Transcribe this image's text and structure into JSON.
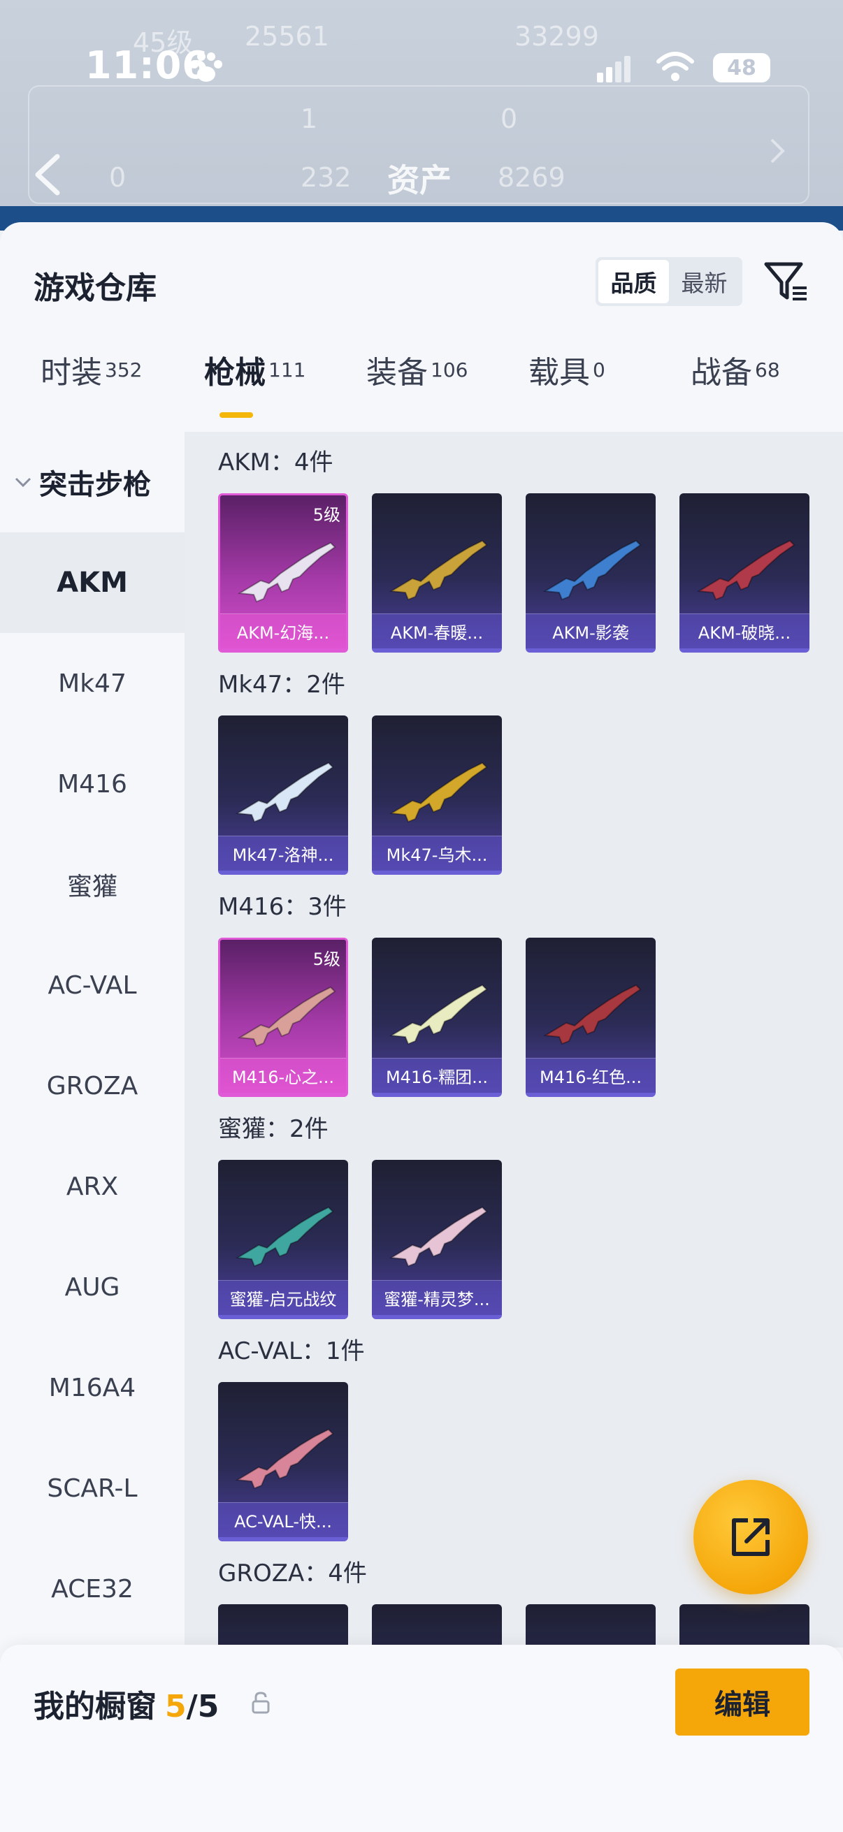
{
  "status_bar": {
    "time": "11:06",
    "battery": "48"
  },
  "background": {
    "ghost_texts": [
      "45级",
      "25561",
      "33299",
      "1",
      "0",
      "0",
      "232",
      "8269"
    ],
    "asset_title": "资产"
  },
  "header": {
    "title": "游戏仓库",
    "sort_options": [
      "品质",
      "最新"
    ],
    "active_sort": "品质"
  },
  "tabs": [
    {
      "label": "时装",
      "count": "352"
    },
    {
      "label": "枪械",
      "count": "111",
      "active": true
    },
    {
      "label": "装备",
      "count": "106"
    },
    {
      "label": "载具",
      "count": "0"
    },
    {
      "label": "战备",
      "count": "68"
    }
  ],
  "sidebar": {
    "group": "突击步枪",
    "items": [
      "AKM",
      "Mk47",
      "M416",
      "蜜獾",
      "AC-VAL",
      "GROZA",
      "ARX",
      "AUG",
      "M16A4",
      "SCAR-L",
      "ACE32"
    ],
    "active": "AKM"
  },
  "sections": [
    {
      "title": "AKM：4件",
      "items": [
        {
          "label": "AKM-幻海...",
          "grade": "5级",
          "rarity": "purple",
          "gun_color": "#e8e2f0"
        },
        {
          "label": "AKM-春暖...",
          "rarity": "blue",
          "gun_color": "#c9a23a"
        },
        {
          "label": "AKM-影袭",
          "rarity": "blue",
          "gun_color": "#3f7fd0"
        },
        {
          "label": "AKM-破晓...",
          "rarity": "blue",
          "gun_color": "#b0394a"
        }
      ]
    },
    {
      "title": "Mk47：2件",
      "items": [
        {
          "label": "Mk47-洛神...",
          "rarity": "blue",
          "gun_color": "#d8e6f5"
        },
        {
          "label": "Mk47-乌木...",
          "rarity": "blue",
          "gun_color": "#d2a72a"
        }
      ]
    },
    {
      "title": "M416：3件",
      "items": [
        {
          "label": "M416-心之...",
          "grade": "5级",
          "rarity": "purple",
          "gun_color": "#d9a09a"
        },
        {
          "label": "M416-糯团...",
          "rarity": "blue",
          "gun_color": "#e8ecc0"
        },
        {
          "label": "M416-红色...",
          "rarity": "blue",
          "gun_color": "#a8383f"
        }
      ]
    },
    {
      "title": "蜜獾：2件",
      "items": [
        {
          "label": "蜜獾-启元战纹",
          "rarity": "blue",
          "gun_color": "#3fa7a0"
        },
        {
          "label": "蜜獾-精灵梦...",
          "rarity": "blue",
          "gun_color": "#e6c4d6"
        }
      ]
    },
    {
      "title": "AC-VAL：1件",
      "items": [
        {
          "label": "AC-VAL-快...",
          "rarity": "blue",
          "gun_color": "#d8859a"
        }
      ]
    },
    {
      "title": "GROZA：4件",
      "items": [
        {
          "label": "",
          "rarity": "blue",
          "gun_color": "#c9a23a"
        },
        {
          "label": "",
          "rarity": "blue",
          "gun_color": "#e07a3a"
        },
        {
          "label": "",
          "rarity": "blue",
          "gun_color": "#c9a23a"
        },
        {
          "label": "",
          "rarity": "blue",
          "gun_color": "#3fa7c0"
        }
      ]
    }
  ],
  "bottom_bar": {
    "label": "我的橱窗",
    "current": "5",
    "sep": "/",
    "total": "5",
    "edit_label": "编辑"
  },
  "colors": {
    "accent": "#f5a70a",
    "underline": "#f5b60a"
  }
}
